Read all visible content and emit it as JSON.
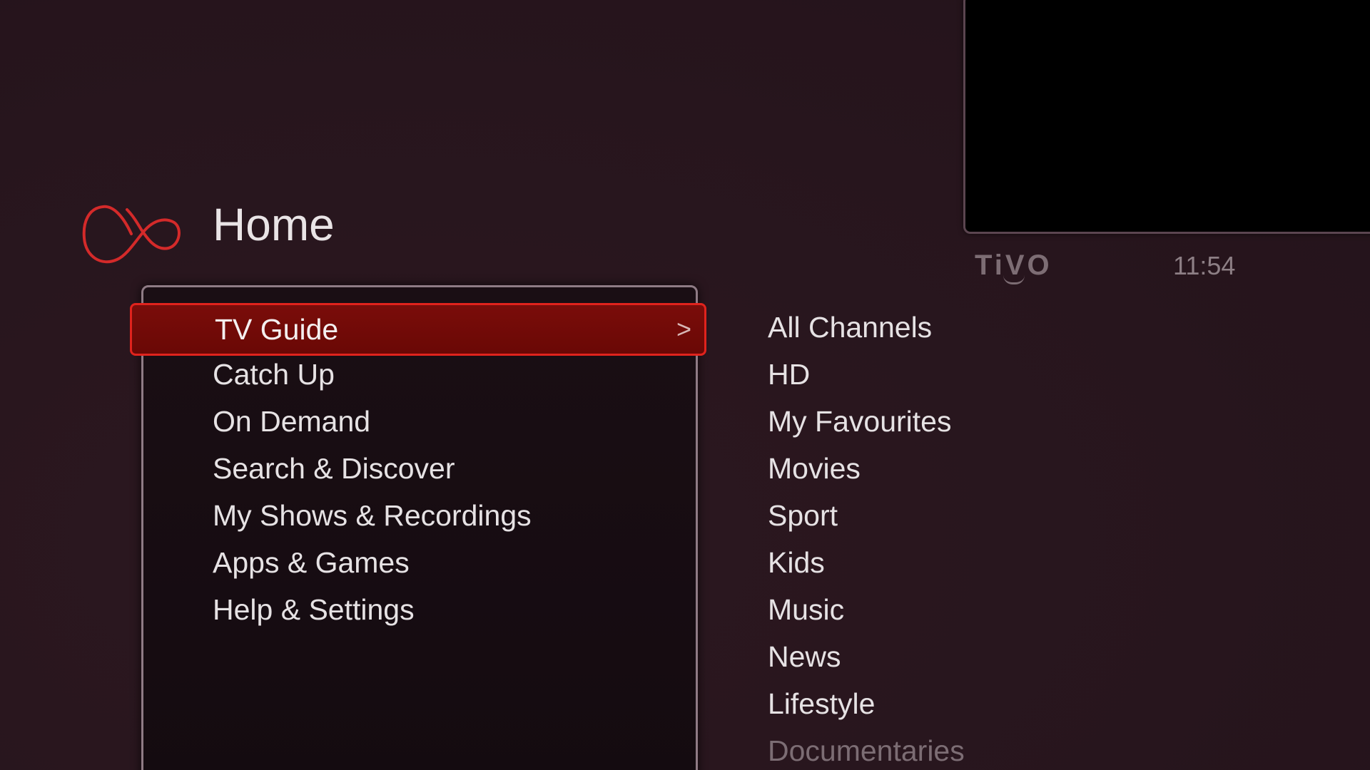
{
  "header": {
    "title": "Home",
    "brand": "TiVO",
    "clock": "11:54"
  },
  "icons": {
    "logo": "infinity-logo-icon",
    "chevron": "chevron-right-icon"
  },
  "colors": {
    "background": "#2a1720",
    "selection_fill": "#7a0d0a",
    "selection_border": "#e0231d",
    "logo": "#d42a2a",
    "text": "#e6e2e4",
    "muted": "#7c6d74"
  },
  "main_menu": {
    "items": [
      {
        "label": "TV Guide",
        "selected": true
      },
      {
        "label": "Catch Up",
        "selected": false
      },
      {
        "label": "On Demand",
        "selected": false
      },
      {
        "label": "Search & Discover",
        "selected": false
      },
      {
        "label": "My Shows & Recordings",
        "selected": false
      },
      {
        "label": "Apps & Games",
        "selected": false
      },
      {
        "label": "Help & Settings",
        "selected": false
      }
    ],
    "chevron": ">"
  },
  "sub_menu": {
    "items": [
      {
        "label": "All Channels"
      },
      {
        "label": "HD"
      },
      {
        "label": "My Favourites"
      },
      {
        "label": "Movies"
      },
      {
        "label": "Sport"
      },
      {
        "label": "Kids"
      },
      {
        "label": "Music"
      },
      {
        "label": "News"
      },
      {
        "label": "Lifestyle"
      },
      {
        "label": "Documentaries"
      }
    ]
  }
}
